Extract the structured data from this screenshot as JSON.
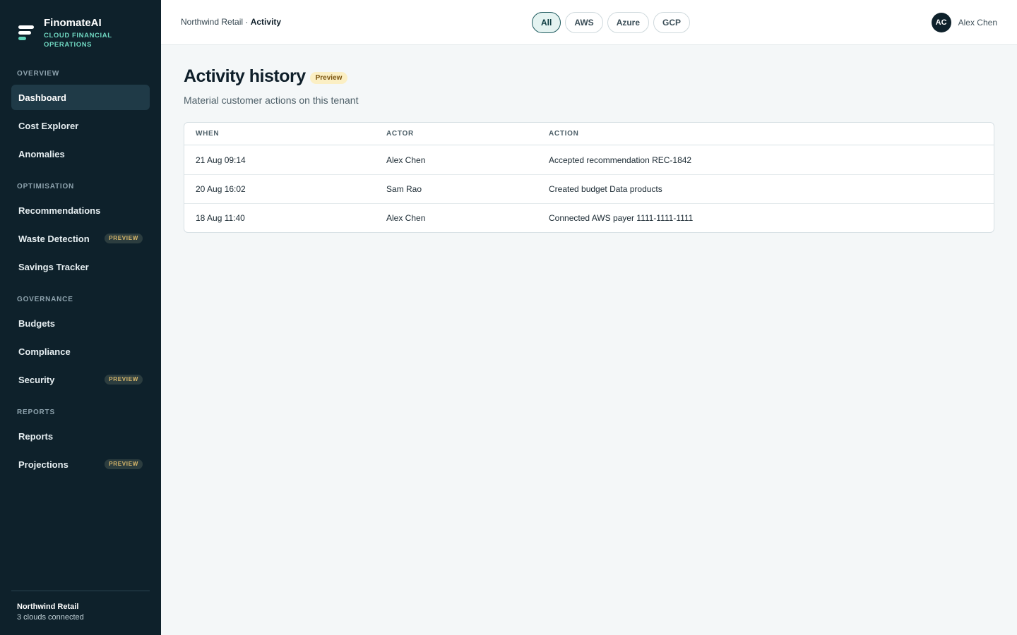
{
  "brand": {
    "name": "FinomateAI",
    "subtitle": "CLOUD FINANCIAL OPERATIONS"
  },
  "sidebar": {
    "sections": [
      {
        "label": "OVERVIEW",
        "items": [
          {
            "label": "Dashboard",
            "active": true
          },
          {
            "label": "Cost Explorer"
          },
          {
            "label": "Anomalies"
          }
        ]
      },
      {
        "label": "OPTIMISATION",
        "items": [
          {
            "label": "Recommendations"
          },
          {
            "label": "Waste Detection",
            "badge": "PREVIEW"
          },
          {
            "label": "Savings Tracker"
          }
        ]
      },
      {
        "label": "GOVERNANCE",
        "items": [
          {
            "label": "Budgets"
          },
          {
            "label": "Compliance"
          },
          {
            "label": "Security",
            "badge": "PREVIEW"
          }
        ]
      },
      {
        "label": "REPORTS",
        "items": [
          {
            "label": "Reports"
          },
          {
            "label": "Projections",
            "badge": "PREVIEW"
          }
        ]
      }
    ],
    "footer": {
      "tenant": "Northwind Retail",
      "status": "3 clouds connected"
    }
  },
  "topbar": {
    "breadcrumb": {
      "parent": "Northwind Retail",
      "separator": " · ",
      "current": "Activity"
    },
    "filters": [
      {
        "label": "All",
        "active": true
      },
      {
        "label": "AWS"
      },
      {
        "label": "Azure"
      },
      {
        "label": "GCP"
      }
    ],
    "user": {
      "initials": "AC",
      "name": "Alex Chen"
    }
  },
  "main": {
    "title": "Activity history",
    "title_badge": "Preview",
    "subtitle": "Material customer actions on this tenant",
    "table": {
      "columns": [
        "WHEN",
        "ACTOR",
        "ACTION"
      ],
      "rows": [
        {
          "when": "21 Aug 09:14",
          "actor": "Alex Chen",
          "action": "Accepted recommendation REC-1842"
        },
        {
          "when": "20 Aug 16:02",
          "actor": "Sam Rao",
          "action": "Created budget Data products"
        },
        {
          "when": "18 Aug 11:40",
          "actor": "Alex Chen",
          "action": "Connected AWS payer 1111-1111-1111"
        }
      ]
    }
  },
  "colors": {
    "sidebar_bg": "#0e212b",
    "accent": "#6fd6c0",
    "active_chip_border": "#1e5a5e",
    "badge_bg": "#fbefc4"
  }
}
